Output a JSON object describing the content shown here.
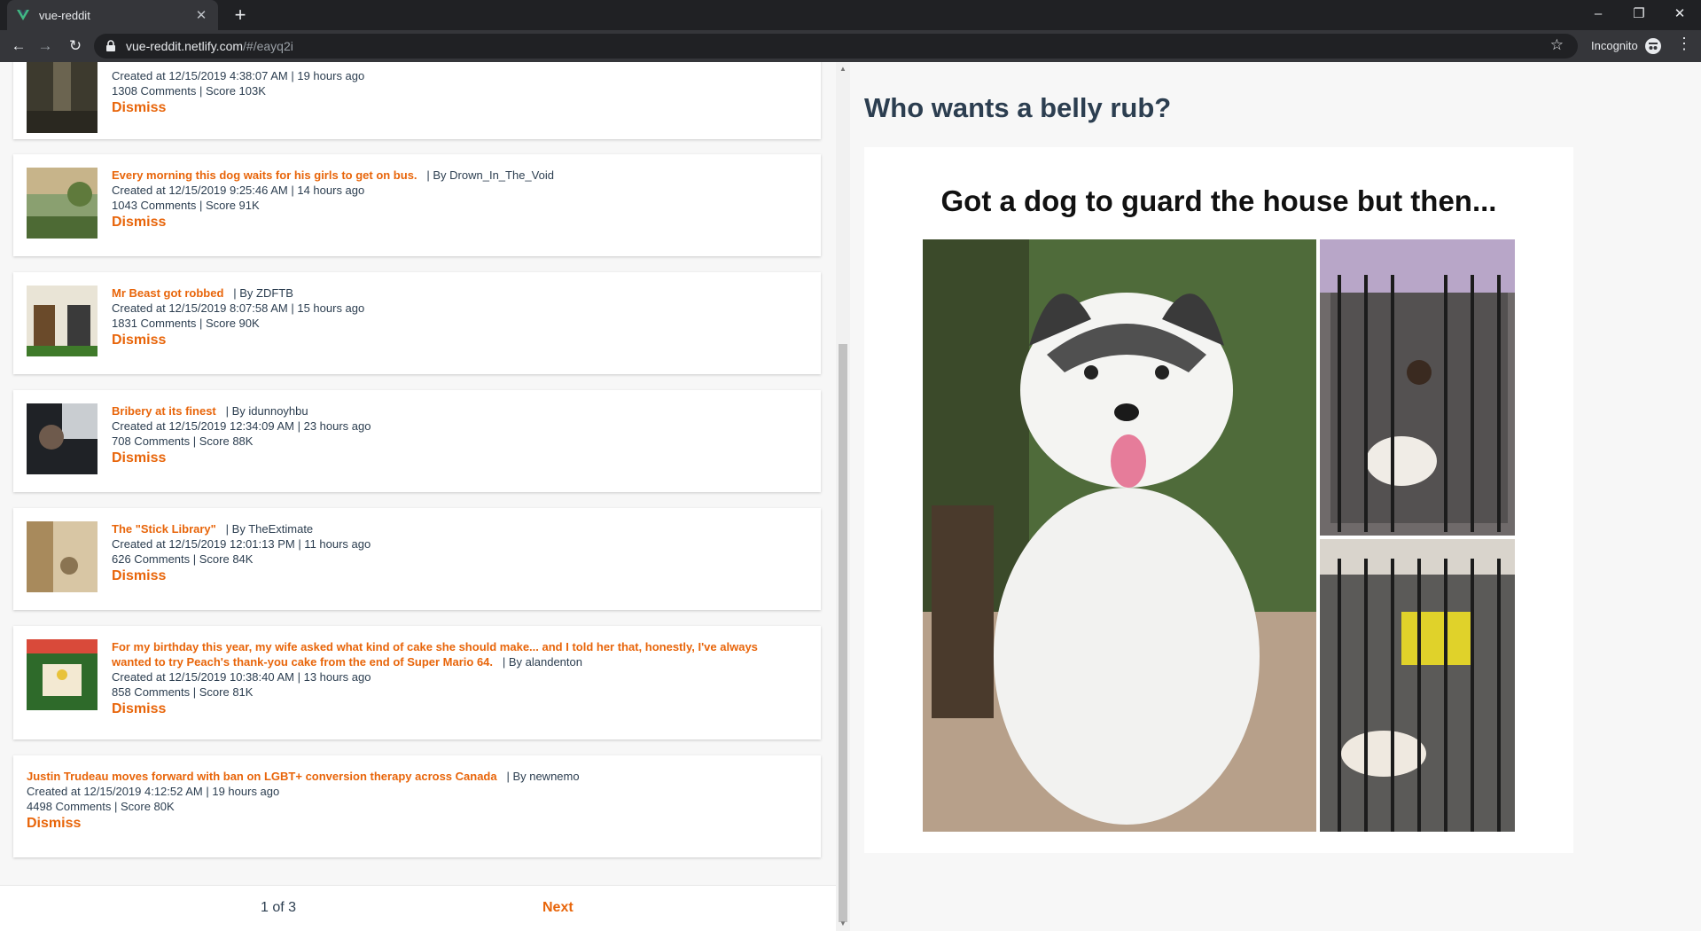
{
  "browser": {
    "tab_title": "vue-reddit",
    "url_host": "vue-reddit.netlify.com",
    "url_path": "/#/eayq2i",
    "incognito_label": "Incognito",
    "icons": [
      "vue-favicon-icon",
      "close-icon",
      "plus-icon",
      "back-icon",
      "forward-icon",
      "reload-icon",
      "lock-icon",
      "star-icon",
      "incognito-icon",
      "menu-icon",
      "minimize-icon",
      "restore-icon",
      "close-window-icon"
    ]
  },
  "posts": [
    {
      "title": "",
      "author": "",
      "created": "Created at 12/15/2019 4:38:07 AM | 19 hours ago",
      "stats": "1308 Comments | Score 103K",
      "dismiss": "Dismiss"
    },
    {
      "title": "Every morning this dog waits for his girls to get on bus.",
      "author": "| By Drown_In_The_Void",
      "created": "Created at 12/15/2019 9:25:46 AM | 14 hours ago",
      "stats": "1043 Comments | Score 91K",
      "dismiss": "Dismiss"
    },
    {
      "title": "Mr Beast got robbed",
      "author": "| By ZDFTB",
      "created": "Created at 12/15/2019 8:07:58 AM | 15 hours ago",
      "stats": "1831 Comments | Score 90K",
      "dismiss": "Dismiss"
    },
    {
      "title": "Bribery at its finest",
      "author": "| By idunnoyhbu",
      "created": "Created at 12/15/2019 12:34:09 AM | 23 hours ago",
      "stats": "708 Comments | Score 88K",
      "dismiss": "Dismiss"
    },
    {
      "title": "The \"Stick Library\"",
      "author": "| By TheExtimate",
      "created": "Created at 12/15/2019 12:01:13 PM | 11 hours ago",
      "stats": "626 Comments | Score 84K",
      "dismiss": "Dismiss"
    },
    {
      "title": "For my birthday this year, my wife asked what kind of cake she should make... and I told her that, honestly, I've always wanted to try Peach's thank-you cake from the end of Super Mario 64.",
      "author": "| By alandenton",
      "created": "Created at 12/15/2019 10:38:40 AM | 13 hours ago",
      "stats": "858 Comments | Score 81K",
      "dismiss": "Dismiss"
    },
    {
      "title": "Justin Trudeau moves forward with ban on LGBT+ conversion therapy across Canada",
      "author": "| By newnemo",
      "created": "Created at 12/15/2019 4:12:52 AM | 19 hours ago",
      "stats": "4498 Comments | Score 80K",
      "dismiss": "Dismiss"
    }
  ],
  "pager": {
    "status": "1 of 3",
    "next": "Next"
  },
  "detail": {
    "title": "Who wants a belly rub?",
    "image_caption": "Got a dog to guard the house but then..."
  },
  "colors": {
    "accent": "#e8650a",
    "text": "#2c3e50",
    "chrome_dark": "#202124",
    "chrome_mid": "#35363a"
  }
}
